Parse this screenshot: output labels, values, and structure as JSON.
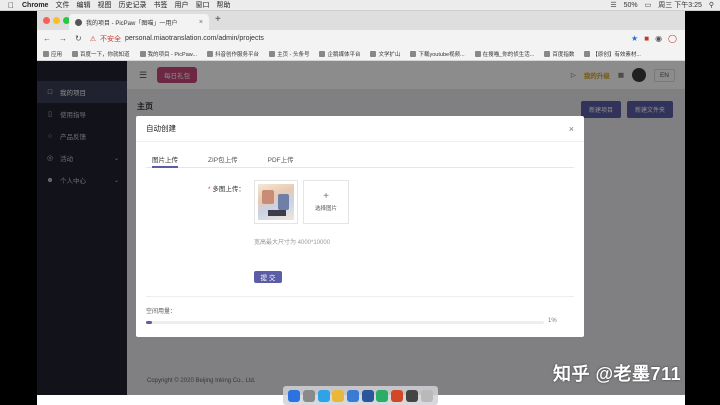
{
  "menubar": {
    "app": "Chrome",
    "items": [
      "文件",
      "编辑",
      "视图",
      "历史记录",
      "书签",
      "用户",
      "窗口",
      "帮助"
    ],
    "battery": "50%",
    "datetime": "周三 下午3:25"
  },
  "browser": {
    "tab_title": "我的项目 - PicPaw「图喵」一用户",
    "address_warning": "不安全",
    "url": "personal.miaotranslation.com/admin/projects",
    "bookmarks": [
      "应用",
      "百度一下，你就知道",
      "我的项目 - PicPaw...",
      "抖音创作服务平台",
      "主页 - 头条号",
      "企鹅媒体平台",
      "文学扩山",
      "下载youtube视频...",
      "在搜喵_你的侦生活...",
      "百度指数",
      "【原创】有效素材..."
    ]
  },
  "sidebar": {
    "items": [
      {
        "label": "我的项目",
        "icon": "folder-icon",
        "active": true
      },
      {
        "label": "使用指导",
        "icon": "doc-icon",
        "active": false
      },
      {
        "label": "产品反馈",
        "icon": "feedback-icon",
        "active": false
      },
      {
        "label": "活动",
        "icon": "activity-icon",
        "active": false
      },
      {
        "label": "个人中心",
        "icon": "user-icon",
        "active": false
      }
    ]
  },
  "topbar": {
    "daily_label": "每日礼包",
    "upgrade_label": "我的升级",
    "lang": "EN"
  },
  "background": {
    "page_title": "主页",
    "buttons": [
      "新建项目",
      "新建文件夹"
    ],
    "footer": "Copyright © 2020 Beijing Inking Co., Ltd."
  },
  "modal": {
    "title": "自动创建",
    "tabs": [
      "图片上传",
      "ZIP包上传",
      "PDF上传"
    ],
    "active_tab": 0,
    "field_label": "多图上传：",
    "required_mark": "*",
    "upload_button_label": "选择图片",
    "hint": "宽高最大尺寸为 4000*10000",
    "submit_label": "提 交",
    "space_label": "空间用量：",
    "space_percent_text": "1%",
    "space_fraction": 0.015
  },
  "watermark": "知乎 @老墨711",
  "colors": {
    "accent": "#5b5ea6",
    "daily": "#c8487a",
    "sidebar": "#1f2231"
  }
}
